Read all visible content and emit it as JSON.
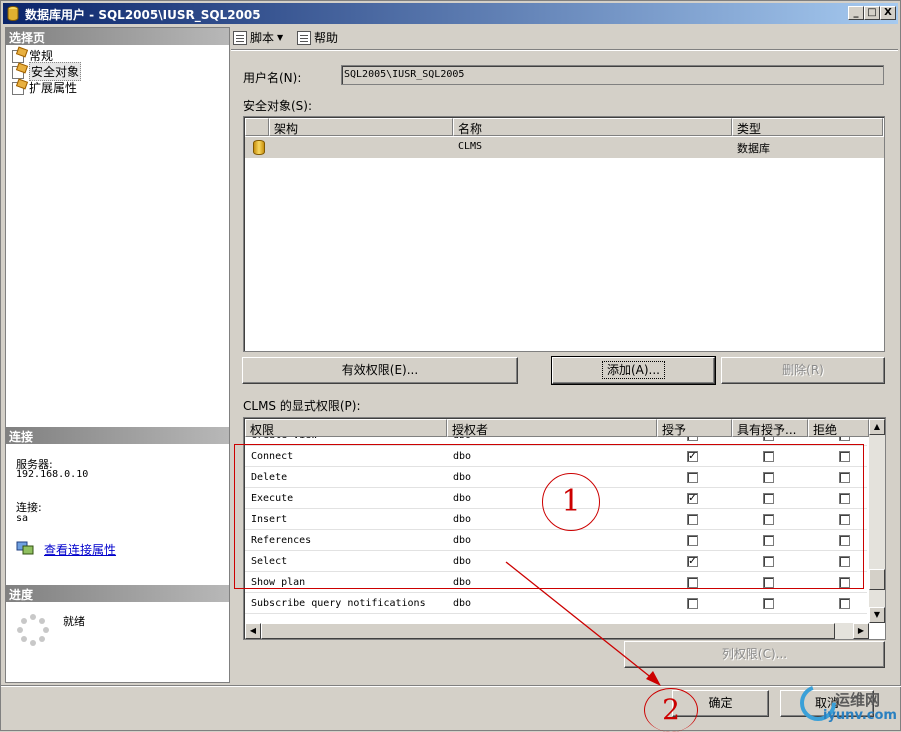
{
  "window": {
    "title": "数据库用户 - SQL2005\\IUSR_SQL2005",
    "controls": {
      "minimize": "_",
      "maximize": "□",
      "close": "X"
    }
  },
  "left_pane": {
    "select_page_header": "选择页",
    "pages": [
      {
        "label": "常规",
        "icon": "page-icon",
        "selected": false
      },
      {
        "label": "安全对象",
        "icon": "page-icon",
        "selected": true
      },
      {
        "label": "扩展属性",
        "icon": "page-icon",
        "selected": false
      }
    ],
    "connection_header": "连接",
    "server_label": "服务器:",
    "server_value": "192.168.0.10",
    "connection_label": "连接:",
    "connection_value": "sa",
    "view_connection_link": "查看连接属性",
    "progress_header": "进度",
    "progress_status": "就绪"
  },
  "toolbar": {
    "script_label": "脚本",
    "help_label": "帮助"
  },
  "form": {
    "username_label": "用户名(N):",
    "username_value": "SQL2005\\IUSR_SQL2005",
    "securables_label": "安全对象(S):",
    "securables_columns": [
      "架构",
      "名称",
      "类型"
    ],
    "securables_rows": [
      {
        "schema": "",
        "name": "CLMS",
        "type": "数据库",
        "icon": "database-icon"
      }
    ],
    "effective_perm_button": "有效权限(E)...",
    "add_button": "添加(A)...",
    "remove_button": "删除(R)",
    "explicit_perm_label": "CLMS 的显式权限(P):",
    "perm_columns": [
      "权限",
      "授权者",
      "授予",
      "具有授予...",
      "拒绝"
    ],
    "perm_rows": [
      {
        "permission": "Create view",
        "grantor": "dbo",
        "grant": false,
        "with_grant": false,
        "deny": false
      },
      {
        "permission": "Connect",
        "grantor": "dbo",
        "grant": true,
        "with_grant": false,
        "deny": false
      },
      {
        "permission": "Delete",
        "grantor": "dbo",
        "grant": false,
        "with_grant": false,
        "deny": false
      },
      {
        "permission": "Execute",
        "grantor": "dbo",
        "grant": true,
        "with_grant": false,
        "deny": false
      },
      {
        "permission": "Insert",
        "grantor": "dbo",
        "grant": false,
        "with_grant": false,
        "deny": false
      },
      {
        "permission": "References",
        "grantor": "dbo",
        "grant": false,
        "with_grant": false,
        "deny": false
      },
      {
        "permission": "Select",
        "grantor": "dbo",
        "grant": true,
        "with_grant": false,
        "deny": false
      },
      {
        "permission": "Show plan",
        "grantor": "dbo",
        "grant": false,
        "with_grant": false,
        "deny": false
      },
      {
        "permission": "Subscribe query notifications",
        "grantor": "dbo",
        "grant": false,
        "with_grant": false,
        "deny": false
      }
    ],
    "column_perm_button": "列权限(C)...",
    "ok_button": "确定",
    "cancel_button": "取消"
  },
  "annotations": {
    "circle_1": "1",
    "circle_2": "2",
    "color": "#cc0000"
  },
  "watermark": {
    "brand": "运维网",
    "url": "iyunv.com"
  }
}
